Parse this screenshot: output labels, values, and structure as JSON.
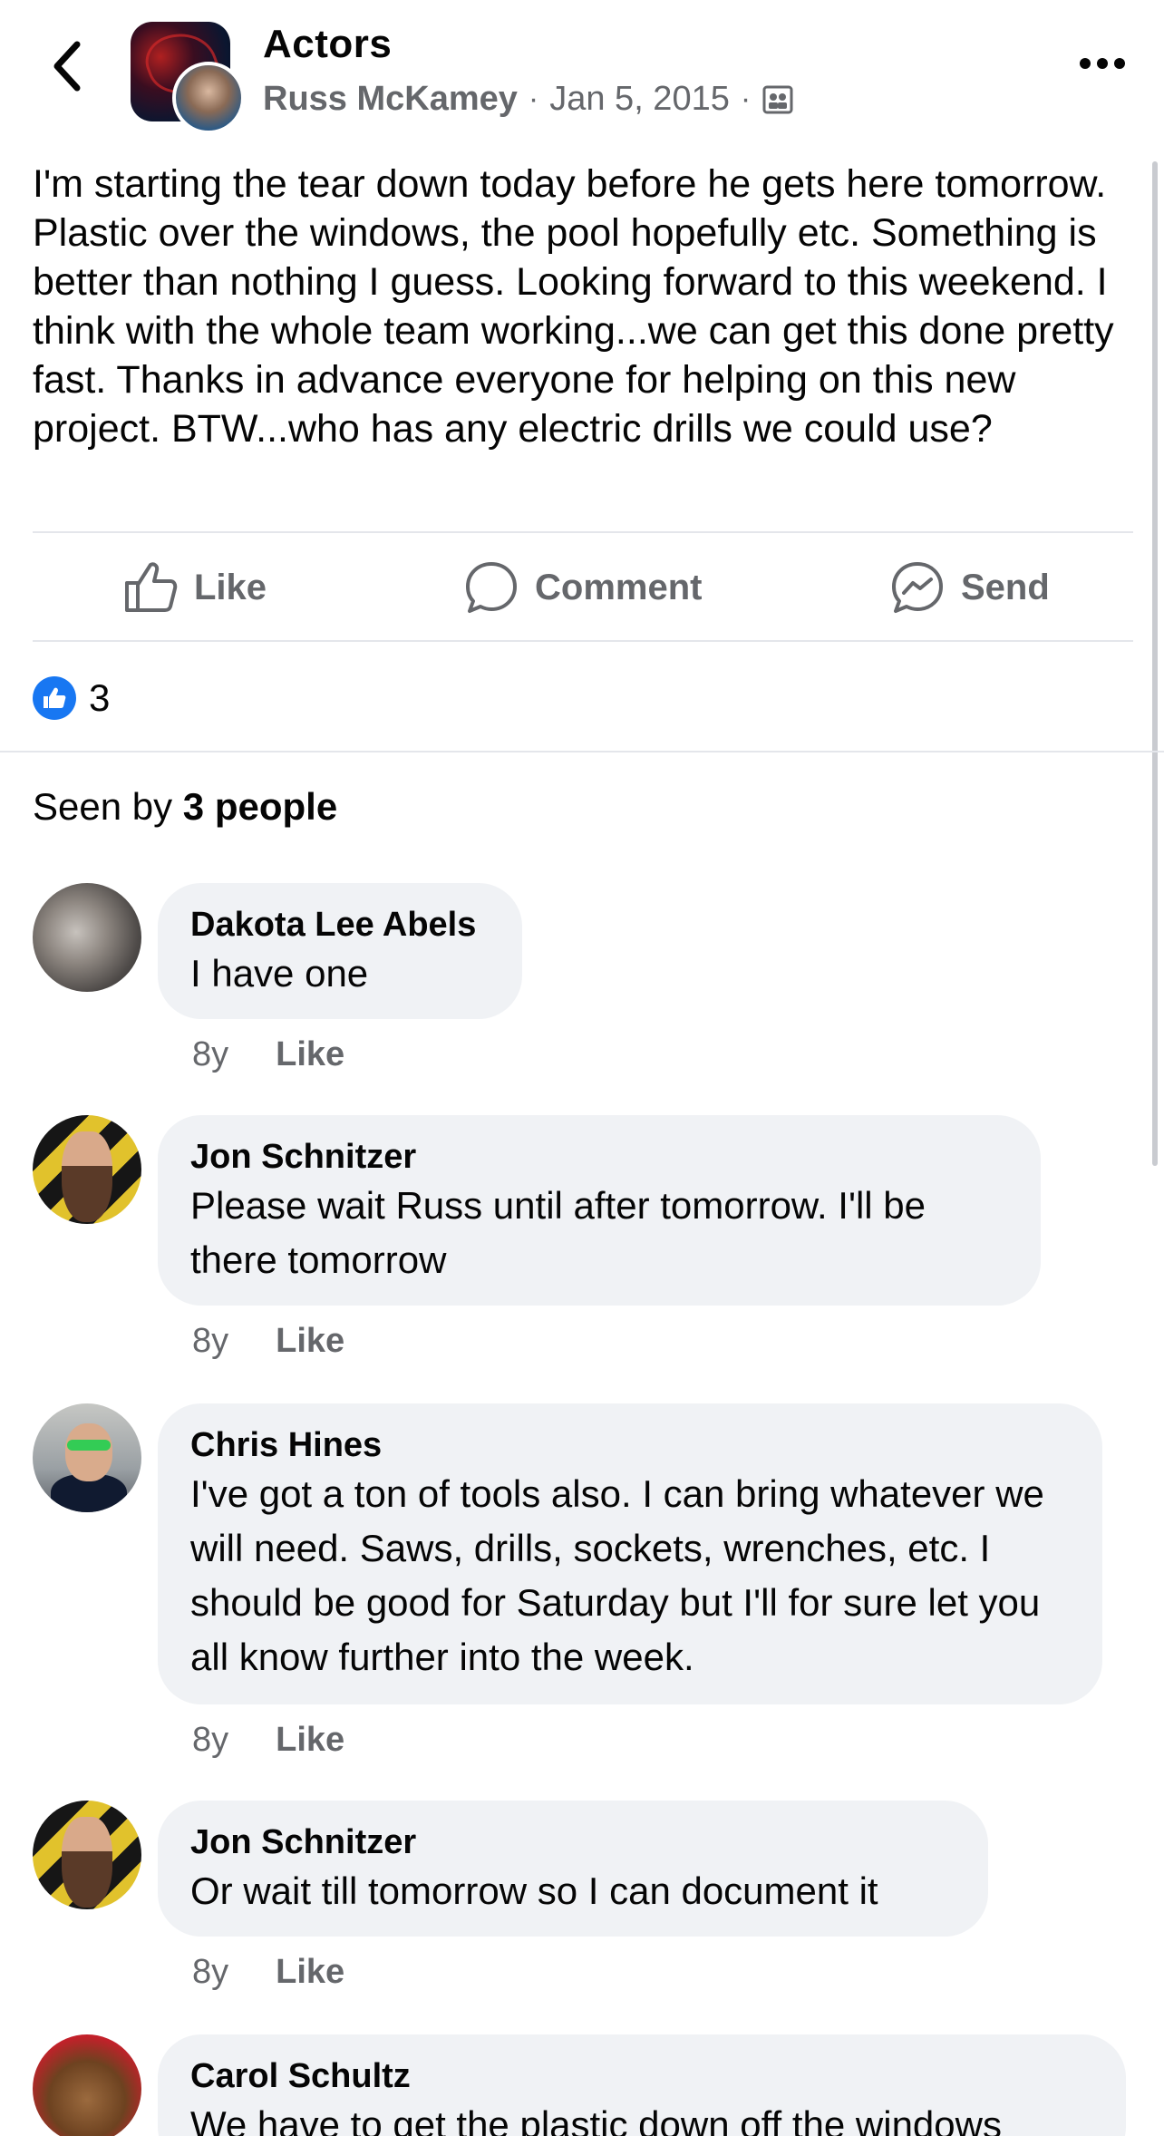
{
  "header": {
    "group_name": "Actors",
    "author": "Russ McKamey",
    "date": "Jan 5, 2015",
    "privacy_icon": "group-privacy-icon"
  },
  "post": {
    "text": "I'm starting the tear down today before he gets here tomorrow. Plastic over the windows, the pool hopefully etc. Something is better than nothing I guess. Looking forward to this weekend. I think with the whole team working...we can get this done pretty fast. Thanks in advance everyone for helping on this new project. BTW...who has any electric drills we could use?"
  },
  "actions": {
    "like": "Like",
    "comment": "Comment",
    "send": "Send"
  },
  "reactions": {
    "count": "3"
  },
  "seen": {
    "prefix": "Seen by",
    "count": "3 people"
  },
  "comments": [
    {
      "name": "Dakota Lee Abels",
      "text": "I have one",
      "time": "8y",
      "like": "Like"
    },
    {
      "name": "Jon Schnitzer",
      "text": "Please wait Russ until after tomorrow. I'll  be there tomorrow",
      "time": "8y",
      "like": "Like"
    },
    {
      "name": "Chris Hines",
      "text": "I've got a ton of tools also. I can bring whatever we will need. Saws, drills, sockets, wrenches, etc. I should be good for Saturday but I'll for sure let you all know further into the week.",
      "time": "8y",
      "like": "Like"
    },
    {
      "name": "Jon Schnitzer",
      "text": "Or wait till tomorrow so I can document it",
      "time": "8y",
      "like": "Like"
    },
    {
      "name": "Carol Schultz",
      "text": "We have to get the plastic down off the windows"
    }
  ],
  "colors": {
    "accent": "#1877f2",
    "muted": "#65676b",
    "bubble": "#f0f2f5"
  }
}
